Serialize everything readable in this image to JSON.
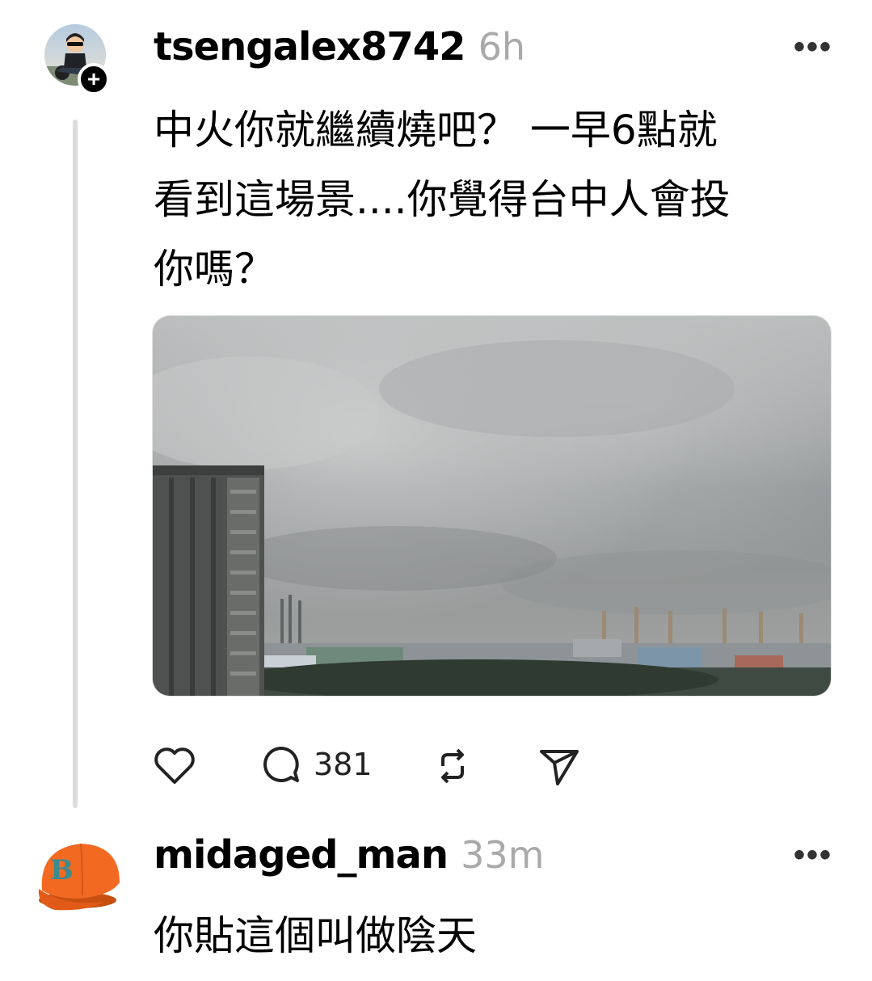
{
  "post": {
    "username": "tsengalex8742",
    "time": "6h",
    "more_label": "•••",
    "follow_badge": "+",
    "text_line1": "中火你就繼續燒吧？ 一早6點就",
    "text_line2": "看到這場景....你覺得台中人會投",
    "text_line3": "你嗎？",
    "image_desc_icon": "photo-icon",
    "comment_count": "381"
  },
  "reply": {
    "username": "midaged_man",
    "time": "33m",
    "more_label": "•••",
    "text": "你貼這個叫做陰天"
  },
  "icons": {
    "like": "heart-icon",
    "comment": "comment-bubble-icon",
    "repost": "repost-icon",
    "share": "send-icon",
    "more": "more-dots-icon"
  },
  "colors": {
    "meta_gray": "#a9a9a9",
    "thread_line": "#dcdcdc",
    "cap_orange": "#f26a22"
  }
}
